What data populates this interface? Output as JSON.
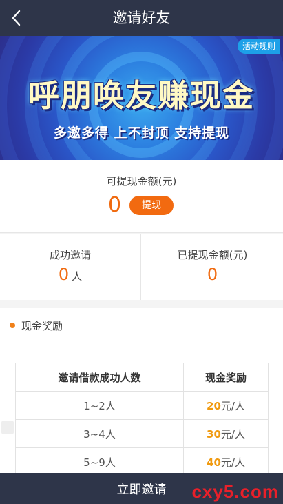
{
  "header": {
    "title": "邀请好友",
    "back_icon": "chevron-left-icon"
  },
  "banner": {
    "rules_label": "活动规则",
    "headline": "呼朋唤友赚现金",
    "subline": "多邀多得 上不封顶 支持提现"
  },
  "withdraw": {
    "label": "可提现金额(元)",
    "amount": "0",
    "button_label": "提现"
  },
  "stats": {
    "invited_label": "成功邀请",
    "invited_value": "0",
    "invited_unit": "人",
    "withdrawn_label": "已提现金额(元)",
    "withdrawn_value": "0"
  },
  "rewards": {
    "section_title": "现金奖励",
    "headers": [
      "邀请借款成功人数",
      "现金奖励"
    ],
    "rows": [
      {
        "range": "1~2人",
        "amount": "20",
        "unit": "元/人"
      },
      {
        "range": "3~4人",
        "amount": "30",
        "unit": "元/人"
      },
      {
        "range": "5~9人",
        "amount": "40",
        "unit": "元/人"
      }
    ]
  },
  "footer": {
    "invite_label": "立即邀请",
    "watermark": "cxy5.com"
  },
  "colors": {
    "nav": "#2e3549",
    "accent": "#f26a10",
    "reward_number": "#f09a10"
  }
}
